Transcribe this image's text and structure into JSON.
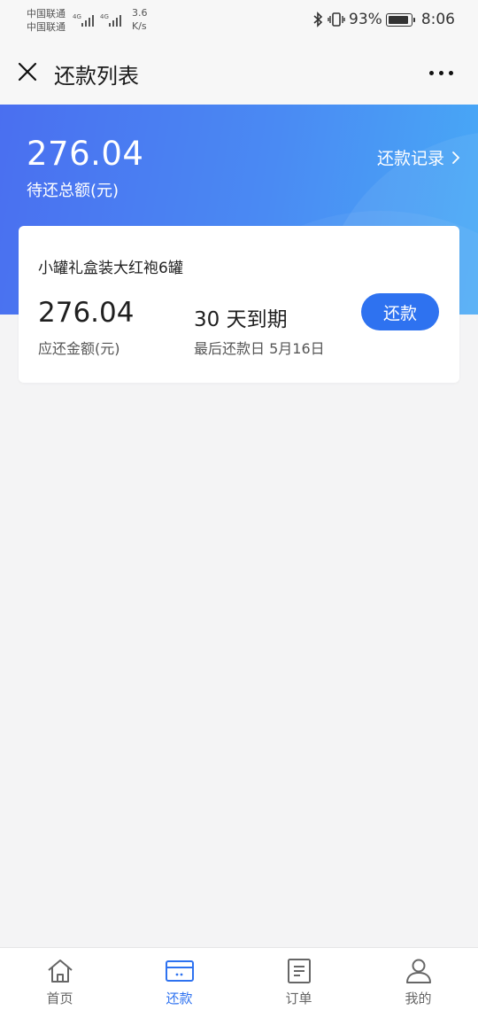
{
  "status_bar": {
    "carrier1": "中国联通",
    "carrier2": "中国联通",
    "network1": "4G",
    "network2": "4G",
    "speed_value": "3.6",
    "speed_unit": "K/s",
    "battery_percent": "93%",
    "time": "8:06"
  },
  "nav": {
    "title": "还款列表",
    "close_icon": "close-icon",
    "more_icon": "more-icon"
  },
  "hero": {
    "total_amount": "276.04",
    "total_label": "待还总额(元)",
    "record_link": "还款记录"
  },
  "card": {
    "title": "小罐礼盒装大红袍6罐",
    "amount": "276.04",
    "amount_label": "应还金额(元)",
    "days": "30 天到期",
    "due_text": "最后还款日 5月16日",
    "repay_button": "还款"
  },
  "tabs": [
    {
      "label": "首页",
      "icon": "home-icon",
      "active": false
    },
    {
      "label": "还款",
      "icon": "card-icon",
      "active": true
    },
    {
      "label": "订单",
      "icon": "order-icon",
      "active": false
    },
    {
      "label": "我的",
      "icon": "profile-icon",
      "active": false
    }
  ],
  "colors": {
    "accent": "#2e72f0",
    "hero_gradient_start": "#4a6ff0",
    "hero_gradient_end": "#48aaf6",
    "background": "#f4f4f5"
  }
}
